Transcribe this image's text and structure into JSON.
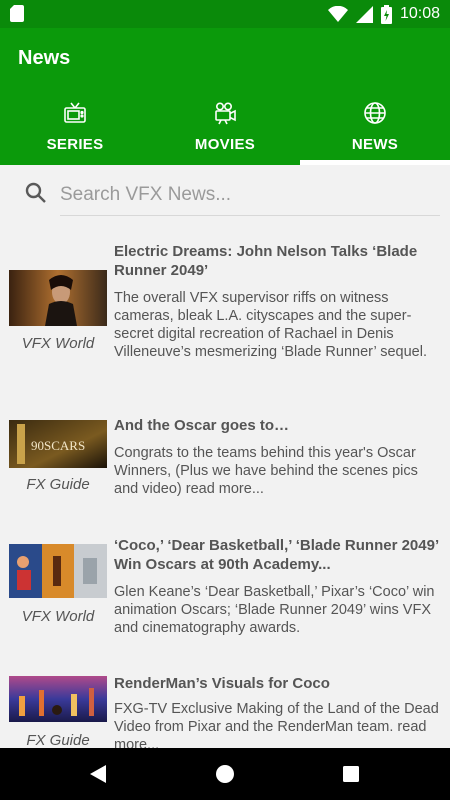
{
  "status_bar": {
    "time": "10:08"
  },
  "app_bar": {
    "title": "News"
  },
  "tabs": [
    {
      "label": "SERIES",
      "icon": "tv-icon"
    },
    {
      "label": "MOVIES",
      "icon": "movie-camera-icon"
    },
    {
      "label": "NEWS",
      "icon": "globe-icon",
      "selected": true
    }
  ],
  "search": {
    "placeholder": "Search VFX News..."
  },
  "articles": [
    {
      "title": "Electric Dreams: John Nelson Talks ‘Blade Runner 2049’",
      "summary": "The overall VFX supervisor riffs on witness cameras, bleak L.A. cityscapes and the super-secret digital recreation of Rachael in Denis Villeneuve’s mesmerizing ‘Blade Runner’ sequel.",
      "source": "VFX World"
    },
    {
      "title": "And the Oscar goes to…",
      "summary": "Congrats to the teams behind this year's Oscar Winners, (Plus we have behind the scenes pics and video) read more...",
      "source": "FX Guide",
      "thumb_text": "90SCARS"
    },
    {
      "title": "‘Coco,’ ‘Dear Basketball,’ ‘Blade Runner 2049’ Win Oscars at 90th Academy...",
      "summary": "Glen Keane’s ‘Dear Basketball,’ Pixar’s ‘Coco’ win animation Oscars; ‘Blade Runner 2049’ wins VFX and cinematography awards.",
      "source": "VFX World"
    },
    {
      "title": "RenderMan’s Visuals for Coco",
      "summary": "FXG-TV Exclusive Making of the Land of the Dead Video from Pixar and the RenderMan team. read more...",
      "source": "FX Guide"
    }
  ],
  "colors": {
    "primary": "#0b9a0b",
    "status_bar": "#0a8a0a",
    "text": "#555555"
  }
}
